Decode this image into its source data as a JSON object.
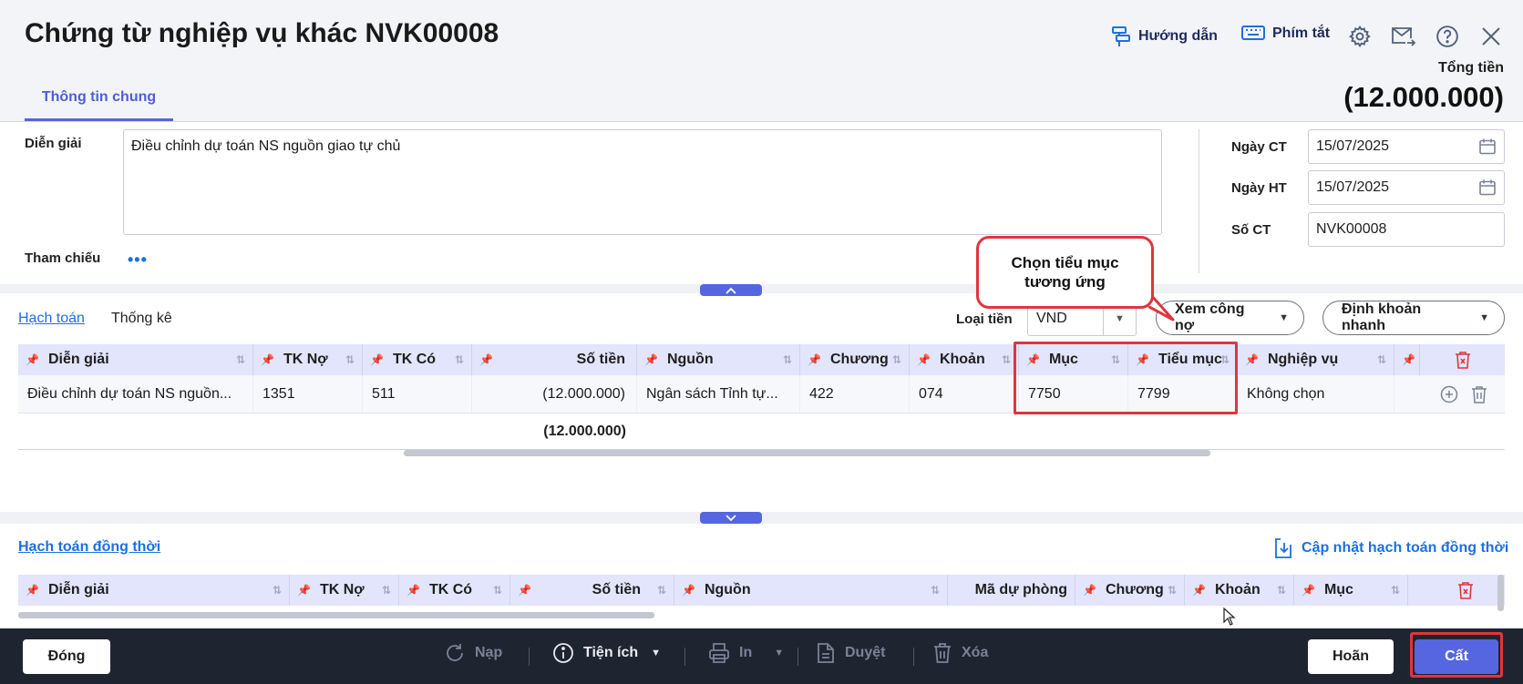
{
  "header": {
    "title": "Chứng từ nghiệp vụ khác NVK00008",
    "guide_label": "Hướng dẫn",
    "shortcut_label": "Phím tắt",
    "total_label": "Tổng tiền",
    "total_value": "(12.000.000)",
    "tab_general": "Thông tin chung"
  },
  "form": {
    "description_label": "Diễn giải",
    "description_value": "Điều chỉnh dự toán NS nguồn giao tự chủ",
    "reference_label": "Tham chiếu",
    "reference_dots": "•••",
    "doc_date_label": "Ngày CT",
    "doc_date_value": "15/07/2025",
    "post_date_label": "Ngày HT",
    "post_date_value": "15/07/2025",
    "doc_no_label": "Số CT",
    "doc_no_value": "NVK00008"
  },
  "callout": {
    "line1": "Chọn tiểu mục",
    "line2": "tương ứng"
  },
  "accounting": {
    "tab_accounting": "Hạch toán",
    "tab_stats": "Thống kê",
    "currency_label": "Loại tiền",
    "currency_value": "VND",
    "view_debt_button": "Xem công nợ",
    "quick_entry_button": "Định khoản nhanh",
    "columns": [
      "Diễn giải",
      "TK Nợ",
      "TK Có",
      "Số tiền",
      "Nguồn",
      "Chương",
      "Khoản",
      "Mục",
      "Tiểu mục",
      "Nghiệp vụ"
    ],
    "row": {
      "description": "Điều chỉnh dự toán NS nguồn...",
      "debit": "1351",
      "credit": "511",
      "amount": "(12.000.000)",
      "source": "Ngân sách Tỉnh tự...",
      "chapter": "422",
      "khoan": "074",
      "muc": "7750",
      "tieu_muc": "7799",
      "business": "Không chọn"
    },
    "total_amount": "(12.000.000)"
  },
  "concurrent": {
    "title": "Hạch toán đồng thời",
    "update_link": "Cập nhật hạch toán đồng thời",
    "columns": [
      "Diễn giải",
      "TK Nợ",
      "TK Có",
      "Số tiền",
      "Nguồn",
      "Mã dự phòng",
      "Chương",
      "Khoản",
      "Mục"
    ]
  },
  "footer": {
    "close": "Đóng",
    "reload": "Nạp",
    "utilities": "Tiện ích",
    "print": "In",
    "approve": "Duyệt",
    "delete": "Xóa",
    "cancel": "Hoãn",
    "save": "Cất"
  },
  "colors": {
    "accent": "#5566e0",
    "header_bg": "#f3f4f8",
    "grid_head_bg": "#e2e5fb",
    "footer_bg": "#1f2431",
    "highlight_red": "#e0353d",
    "link_blue": "#1e6fe0"
  }
}
